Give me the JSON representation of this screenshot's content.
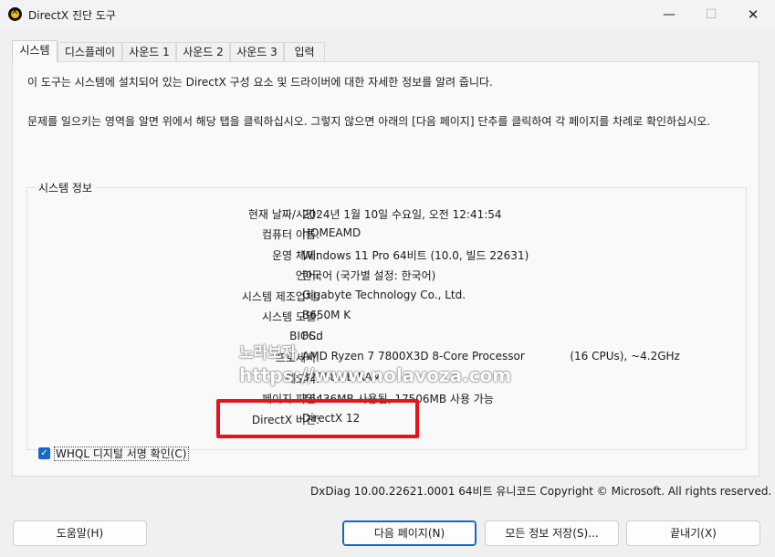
{
  "window": {
    "title": "DirectX 진단 도구",
    "controls": {
      "minimize": "—",
      "maximize": "☐",
      "close": "✕"
    }
  },
  "tabs": [
    {
      "label": "시스템",
      "active": true
    },
    {
      "label": "디스플레이"
    },
    {
      "label": "사운드 1"
    },
    {
      "label": "사운드 2"
    },
    {
      "label": "사운드 3"
    },
    {
      "label": "입력"
    }
  ],
  "intro": {
    "line1": "이 도구는 시스템에 설치되어 있는 DirectX 구성 요소 및 드라이버에 대한 자세한 정보를 알려 줍니다.",
    "line2": "문제를 일으키는 영역을 알면 위에서 해당 탭을 클릭하십시오. 그렇지 않으면 아래의 [다음 페이지] 단추를 클릭하여 각 페이지를 차례로 확인하십시오."
  },
  "system_info": {
    "title": "시스템 정보",
    "rows": [
      {
        "label": "현재 날짜/시간:",
        "value": "2024년 1월 10일 수요일, 오전 12:41:54"
      },
      {
        "label": "컴퓨터 이름:",
        "value": "HOMEAMD"
      },
      {
        "label": "운영 체제:",
        "value": "Windows 11 Pro 64비트 (10.0, 빌드 22631)"
      },
      {
        "label": "언어:",
        "value": "한국어 (국가별 설정: 한국어)"
      },
      {
        "label": "시스템 제조업체:",
        "value": "Gigabyte Technology Co., Ltd."
      },
      {
        "label": "시스템 모델:",
        "value": "B650M K"
      },
      {
        "label": "BIOS:",
        "value": "FCd"
      },
      {
        "label": "프로세서:",
        "value": "AMD Ryzen 7 7800X3D 8-Core Processor             (16 CPUs), ~4.2GHz"
      },
      {
        "label": "메모리:",
        "value": "32768MB RAM"
      },
      {
        "label": "페이지 파일:",
        "value": "16436MB 사용됨, 17506MB 사용 가능"
      },
      {
        "label": "DirectX 버전:",
        "value": "DirectX 12"
      }
    ]
  },
  "whql_checkbox": {
    "label": "WHQL 디지털 서명 확인(C)",
    "checked": true
  },
  "footer_info": "DxDiag 10.00.22621.0001 64비트 유니코드  Copyright © Microsoft. All rights reserved.",
  "buttons": {
    "help": "도움말(H)",
    "next": "다음 페이지(N)",
    "save": "모든 정보 저장(S)...",
    "exit": "끝내기(X)"
  },
  "watermark": {
    "line1": "노라보자",
    "line2": "https://www.nolavoza.com"
  },
  "colors": {
    "highlight_box": "#e4151b",
    "checkbox": "#1769c9",
    "primary_border": "#1767c2"
  }
}
